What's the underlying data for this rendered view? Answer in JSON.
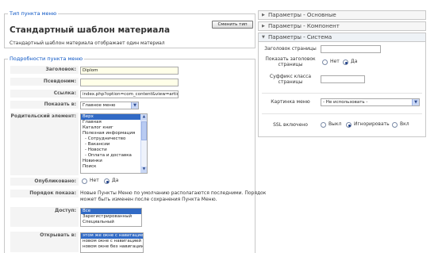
{
  "menu_type": {
    "legend": "Тип пункта меню",
    "title": "Стандартный шаблон материала",
    "description": "Стандартный шаблон материала отображает один материал",
    "change_button": "Сменить тип"
  },
  "details": {
    "legend": "Подробности пункта меню",
    "title_label": "Заголовок:",
    "title_value": "Diplom",
    "alias_label": "Псевдоним:",
    "alias_value": "",
    "link_label": "Ссылка:",
    "link_value": "index.php?option=com_content&view=article",
    "show_in_label": "Показать в:",
    "show_in_value": "Главное меню",
    "parent_label": "Родительский элемент:",
    "parent_items": [
      "Верх",
      "Главная",
      "Каталог книг",
      "Полезная информация",
      "- Сотрудничество",
      "- Вакансии",
      "- Новости",
      "- Оплата и доставка",
      "Новинки",
      "Поиск"
    ],
    "published_label": "Опубликовано:",
    "published_no": "Нет",
    "published_yes": "Да",
    "order_label": "Порядок показа:",
    "order_text_1": "Новые Пункты Меню по умолчанию располагаются последними. Порядок",
    "order_text_2": "может быть изменен после сохранения Пункта Меню.",
    "access_label": "Доступ:",
    "access_items": [
      "Все",
      "Зарегистрированный",
      "Специальный"
    ],
    "open_label": "Открывать в:",
    "open_items": [
      "этом же окне с навигацией",
      "новом окне с навигацией",
      "новом окне без навигации"
    ]
  },
  "panels": {
    "basic": "Параметры - Основные",
    "component": "Параметры - Компонент",
    "system": "Параметры - Система",
    "page_title_label": "Заголовок страницы",
    "page_title_value": "",
    "show_header_label_1": "Показать заголовок",
    "show_header_label_2": "страницы",
    "show_header_no": "Нет",
    "show_header_yes": "Да",
    "class_suffix_label_1": "Суффикс класса",
    "class_suffix_label_2": "страницы",
    "class_suffix_value": "",
    "image_label": "Картинка меню",
    "image_value": "- Не использовать -",
    "ssl_label": "SSL включено",
    "ssl_off": "Выкл",
    "ssl_ignore": "Игнорировать",
    "ssl_on": "Вкл"
  },
  "icons": {
    "select_arrow": "chevron-down-icon",
    "panel_collapsed": "triangle-right-icon",
    "panel_expanded": "triangle-down-icon"
  },
  "colors": {
    "legend_blue": "#0b55c4",
    "selection_blue": "#316ac5",
    "required_yellow": "#ffffe8"
  }
}
